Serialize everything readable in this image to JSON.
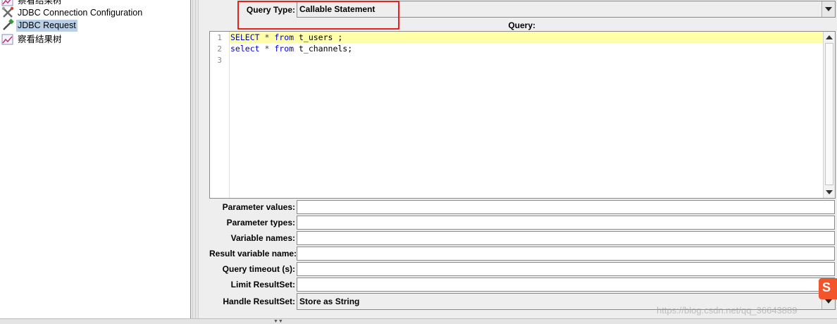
{
  "tree": {
    "items": [
      {
        "label": "察看结果树",
        "icon": "chart-icon",
        "selected": false
      },
      {
        "label": "JDBC Connection Configuration",
        "icon": "wrench-icon",
        "selected": false
      },
      {
        "label": "JDBC Request",
        "icon": "pipette-icon",
        "selected": true
      },
      {
        "label": "察看结果树",
        "icon": "chart-icon",
        "selected": false
      }
    ]
  },
  "form": {
    "query_type_label": "Query Type:",
    "query_type_value": "Callable Statement",
    "query_label": "Query:",
    "query_lines": [
      {
        "no": "1",
        "tokens": [
          [
            "kw",
            "SELECT"
          ],
          [
            "plain",
            " "
          ],
          [
            "op",
            "*"
          ],
          [
            "plain",
            " "
          ],
          [
            "kw",
            "from"
          ],
          [
            "plain",
            " t_users ;"
          ]
        ]
      },
      {
        "no": "2",
        "tokens": [
          [
            "kw",
            "select"
          ],
          [
            "plain",
            " "
          ],
          [
            "op",
            "*"
          ],
          [
            "plain",
            " "
          ],
          [
            "kw",
            "from"
          ],
          [
            "plain",
            " t_channels;"
          ]
        ]
      },
      {
        "no": "3",
        "tokens": []
      }
    ],
    "parameter_values_label": "Parameter values:",
    "parameter_values": "",
    "parameter_types_label": "Parameter types:",
    "parameter_types": "",
    "variable_names_label": "Variable names:",
    "variable_names": "",
    "result_variable_name_label": "Result variable name:",
    "result_variable_name": "",
    "query_timeout_label": "Query timeout (s):",
    "query_timeout": "",
    "limit_resultset_label": "Limit ResultSet:",
    "limit_resultset": "",
    "handle_resultset_label": "Handle ResultSet:",
    "handle_resultset_value": "Store as String"
  },
  "watermark": "https://blog.csdn.net/qq_36643889",
  "badge": "S",
  "colors": {
    "highlight_box": "#e8221b",
    "current_line": "#ffffaa",
    "keyword": "#0000c8",
    "selected_tree": "#b8cfe5"
  }
}
